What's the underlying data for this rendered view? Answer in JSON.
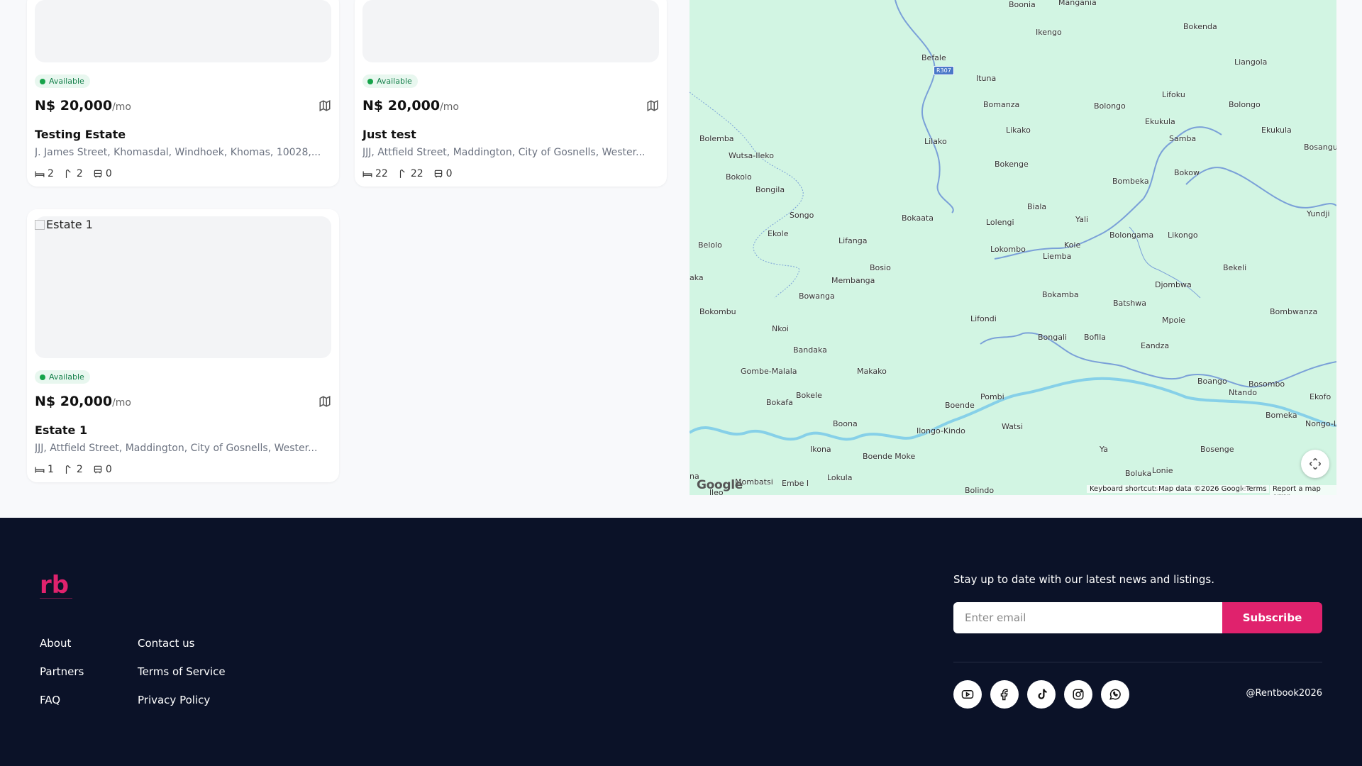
{
  "listings": [
    {
      "image_alt": "",
      "status": "Available",
      "price": "N$ 20,000",
      "per": "/mo",
      "title": "Testing Estate",
      "address": "J. James Street, Khomasdal, Windhoek, Khomas, 10028,...",
      "beds": "2",
      "baths": "2",
      "parking": "0"
    },
    {
      "image_alt": "",
      "status": "Available",
      "price": "N$ 20,000",
      "per": "/mo",
      "title": "Just test",
      "address": "JJJ, Attfield Street, Maddington, City of Gosnells, Wester...",
      "beds": "22",
      "baths": "22",
      "parking": "0"
    },
    {
      "image_alt": "Estate 1",
      "status": "Available",
      "price": "N$ 20,000",
      "per": "/mo",
      "title": "Estate 1",
      "address": "JJJ, Attfield Street, Maddington, City of Gosnells, Wester...",
      "beds": "1",
      "baths": "2",
      "parking": "0"
    }
  ],
  "map": {
    "route_shield": "R307",
    "places": [
      "Boonia",
      "Mangania",
      "Ikengo",
      "Bokenda",
      "Liangola",
      "Befale",
      "Ituna",
      "Lifoku",
      "Bomanza",
      "Bolongo",
      "Bolongo",
      "Ekukula",
      "Ekukula",
      "Samba",
      "Bosangu",
      "Bolemba",
      "Likako",
      "Lilako",
      "Wutsa-Ileko",
      "Bokolo",
      "Bokenge",
      "Bombeka",
      "Bokow",
      "Bongila",
      "Songo",
      "Bokaata",
      "Biala",
      "Yali",
      "Lolengi",
      "Yundji",
      "Ekole",
      "Lifanga",
      "Belolo",
      "Lokombo",
      "Koie",
      "Liemba",
      "Bolongama",
      "Likongo",
      "Bosio",
      "aka",
      "Membanga",
      "Bekeli",
      "Djombwa",
      "Bowanga",
      "Bokamba",
      "Batshwa",
      "Bokombu",
      "Bombwanza",
      "Nkoi",
      "Lifondi",
      "Mpoie",
      "Bongali",
      "Bofila",
      "Bandaka",
      "Eandza",
      "Gombe-Malala",
      "Makako",
      "Boango",
      "Bosombo",
      "Ntando",
      "Bokafa",
      "Bokele",
      "Pombi",
      "Boende",
      "Ekofo",
      "Bomeka",
      "Boona",
      "Nongo-L",
      "Ilongo-Kindo",
      "Watsi",
      "Ikona",
      "Boende Moke",
      "Ya",
      "Bosenge",
      "Lonie",
      "Boluka",
      "Mombatsi",
      "Embe I",
      "Lokula",
      "Bolindo",
      "na",
      "lleo"
    ],
    "attribution": [
      "Keyboard shortcuts",
      "Map data ©2026 Google",
      "Terms",
      "Report a map error"
    ],
    "google_label": "Google"
  },
  "footer": {
    "links_col1": [
      "About",
      "Partners",
      "FAQ"
    ],
    "links_col2": [
      "Contact us",
      "Terms of Service",
      "Privacy Policy"
    ],
    "newsletter_text": "Stay up to date with our latest news and listings.",
    "email_placeholder": "Enter email",
    "subscribe_label": "Subscribe",
    "socials": [
      "youtube-icon",
      "facebook-icon",
      "tiktok-icon",
      "instagram-icon",
      "whatsapp-icon"
    ],
    "copyright": "@Rentbook2026",
    "logo_text": "rb",
    "brand_color": "#e0226d",
    "background": "#0b1228"
  }
}
